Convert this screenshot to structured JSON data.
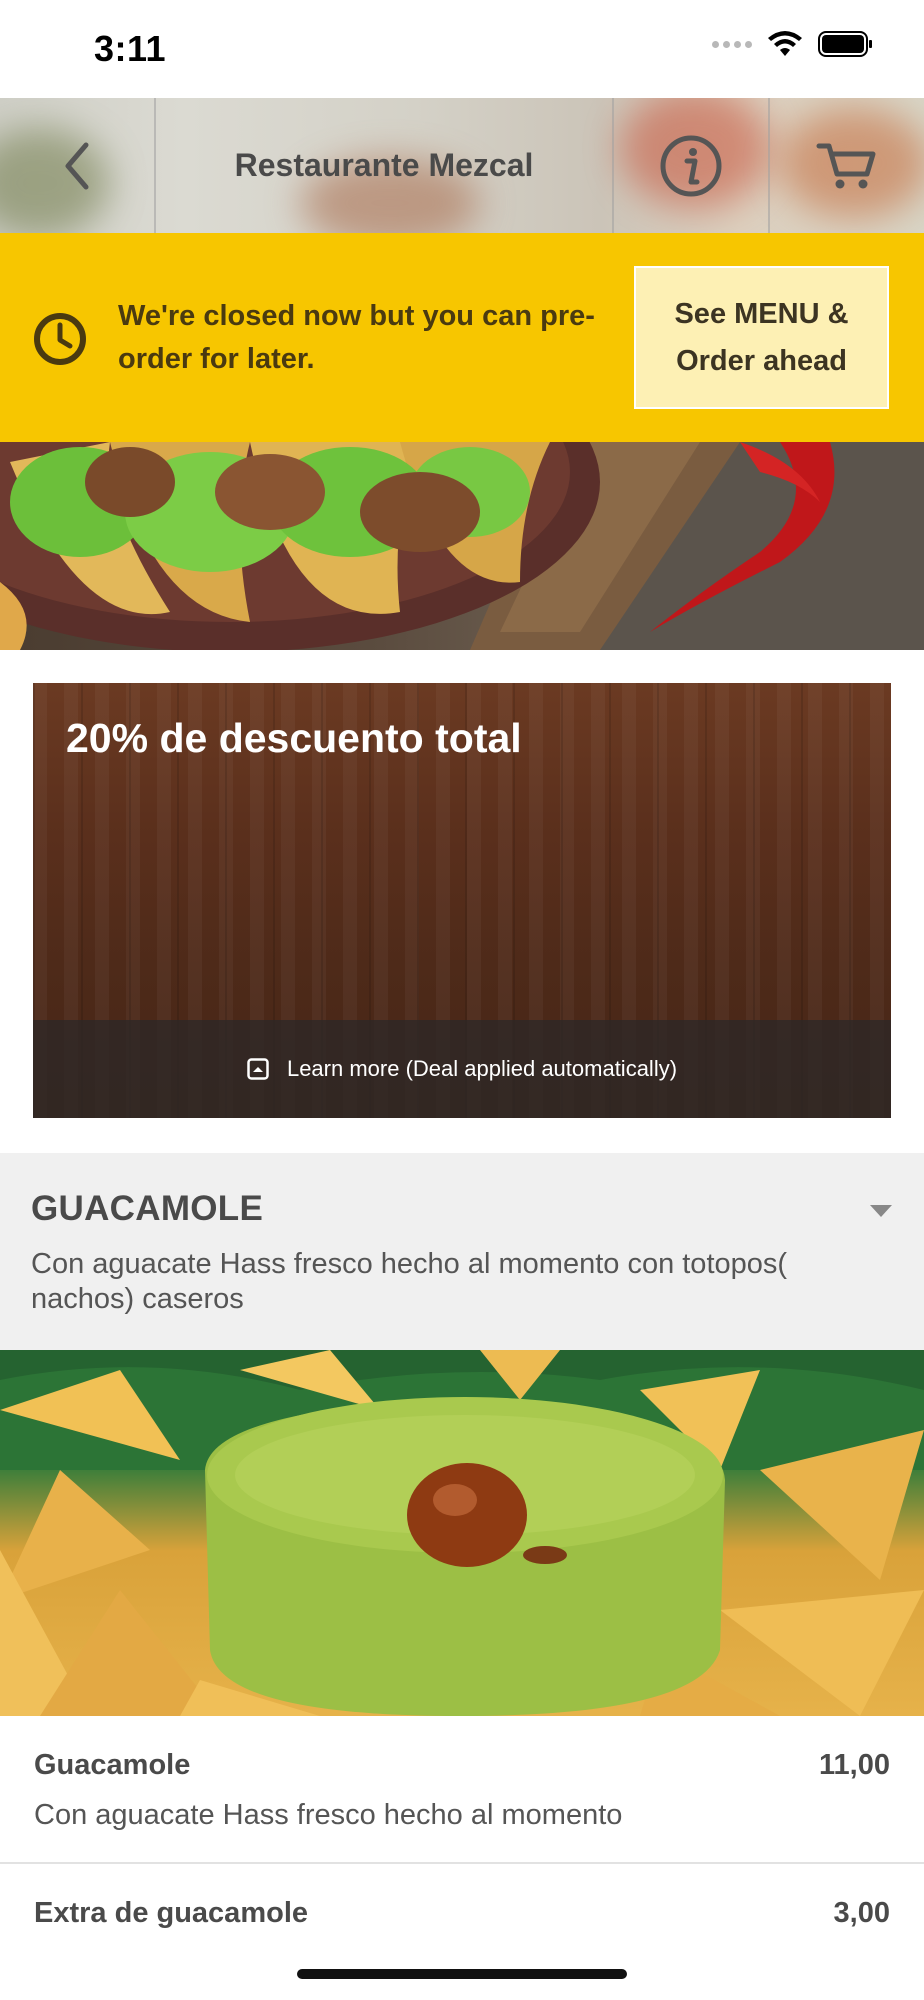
{
  "status_bar": {
    "time": "3:11",
    "icons": [
      "signal-icon",
      "wifi-icon",
      "battery-icon"
    ]
  },
  "nav": {
    "title": "Restaurante Mezcal",
    "back_icon": "chevron-left-icon",
    "info_icon": "info-icon",
    "cart_icon": "cart-icon"
  },
  "closed_banner": {
    "message": "We're closed now but you can pre-order for later.",
    "button_label": "See MENU & Order ahead",
    "icon": "clock-icon",
    "background_color": "#f7c600"
  },
  "deal": {
    "title": "20% de descuento total",
    "footer_text": "Learn more (Deal applied automatically)",
    "footer_icon": "expand-icon"
  },
  "category": {
    "title": "GUACAMOLE",
    "description": "Con aguacate Hass fresco hecho al momento con totopos( nachos) caseros",
    "toggle_icon": "caret-down-icon"
  },
  "items": [
    {
      "name": "Guacamole",
      "price": "11,00",
      "description": "Con aguacate Hass fresco hecho al momento"
    },
    {
      "name": "Extra de guacamole",
      "price": "3,00"
    }
  ]
}
